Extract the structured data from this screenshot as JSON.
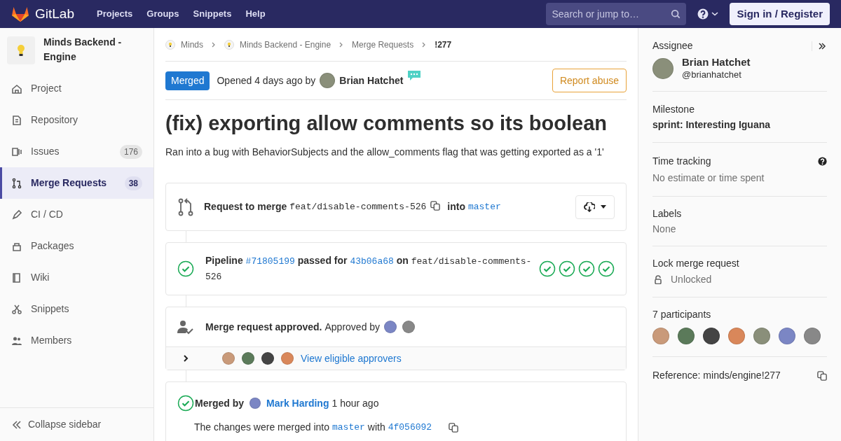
{
  "header": {
    "logo": "GitLab",
    "nav": [
      "Projects",
      "Groups",
      "Snippets",
      "Help"
    ],
    "search": {
      "placeholder": "Search or jump to…"
    },
    "sign_in": "Sign in / Register"
  },
  "sidebar": {
    "project": "Minds Backend - Engine",
    "items": [
      {
        "label": "Project",
        "selected": false
      },
      {
        "label": "Repository",
        "selected": false
      },
      {
        "label": "Issues",
        "count": "176",
        "selected": false
      },
      {
        "label": "Merge Requests",
        "count": "38",
        "selected": true
      },
      {
        "label": "CI / CD",
        "selected": false
      },
      {
        "label": "Packages",
        "selected": false
      },
      {
        "label": "Wiki",
        "selected": false
      },
      {
        "label": "Snippets",
        "selected": false
      },
      {
        "label": "Members",
        "selected": false
      }
    ],
    "collapse": "Collapse sidebar"
  },
  "breadcrumbs": [
    "Minds",
    "Minds Backend - Engine",
    "Merge Requests",
    "!277"
  ],
  "merge_request": {
    "status": "Merged",
    "opened": "Opened 4 days ago by",
    "author": "Brian Hatchet",
    "report": "Report abuse",
    "title": "(fix) exporting allow comments so its boolean",
    "description": "Ran into a bug with BehaviorSubjects and the allow_comments flag that was getting exported as a '1'"
  },
  "request_widget": {
    "label": "Request to merge",
    "source": "feat/disable-comments-526",
    "into": "into",
    "target": "master"
  },
  "pipeline_widget": {
    "label": "Pipeline",
    "id": "#71805199",
    "passed": "passed for",
    "commit": "43b06a68",
    "on": "on",
    "branch": "feat/disable-comments-526"
  },
  "approval_widget": {
    "label": "Merge request approved.",
    "approved_by": "Approved by",
    "link": "View eligible approvers",
    "expanded": false
  },
  "merged_widget": {
    "label": "Merged by",
    "user": "Mark Harding",
    "time": "1 hour ago",
    "sentence": "The changes were merged into",
    "target": "master",
    "with": "with",
    "commit": "4f056092"
  },
  "right_sidebar": {
    "assignee": {
      "heading": "Assignee",
      "name": "Brian Hatchet",
      "username": "@brianhatchet"
    },
    "milestone": {
      "heading": "Milestone",
      "value": "sprint: Interesting Iguana"
    },
    "time_tracking": {
      "heading": "Time tracking",
      "value": "No estimate or time spent"
    },
    "labels": {
      "heading": "Labels",
      "value": "None"
    },
    "lock": {
      "heading": "Lock merge request",
      "value": "Unlocked"
    },
    "participants": {
      "heading": "7 participants"
    },
    "reference": "Reference: minds/engine!277"
  }
}
